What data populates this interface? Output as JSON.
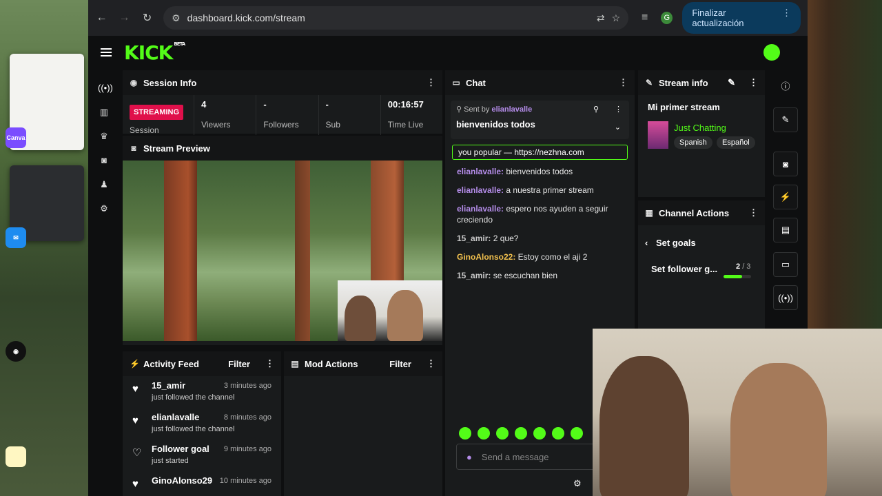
{
  "browser": {
    "url": "dashboard.kick.com/stream",
    "update_button": "Finalizar actualización",
    "profile_letter": "G"
  },
  "desktop": {
    "canva_label": "Canva"
  },
  "kick": {
    "logo": "KICK",
    "logo_badge": "BETA"
  },
  "session": {
    "title": "Session Info",
    "status_badge": "STREAMING",
    "status_label": "Session",
    "stats": [
      {
        "value": "4",
        "label": "Viewers"
      },
      {
        "value": "-",
        "label": "Followers"
      },
      {
        "value": "-",
        "label": "Sub"
      },
      {
        "value": "00:16:57",
        "label": "Time Live"
      }
    ]
  },
  "preview": {
    "title": "Stream Preview"
  },
  "activity": {
    "title": "Activity Feed",
    "filter": "Filter",
    "items": [
      {
        "name": "15_amir",
        "sub": "just followed the channel",
        "time": "3 minutes ago"
      },
      {
        "name": "elianlavalle",
        "sub": "just followed the channel",
        "time": "8 minutes ago"
      },
      {
        "name": "Follower goal",
        "sub": "just started",
        "time": "9 minutes ago"
      },
      {
        "name": "GinoAlonso29",
        "sub": "",
        "time": "10 minutes ago"
      }
    ]
  },
  "mod": {
    "title": "Mod Actions",
    "filter": "Filter"
  },
  "chat": {
    "title": "Chat",
    "pinned_prefix": "Sent by",
    "pinned_user": "elianlavalle",
    "pinned_message": "bienvenidos todos",
    "promo": "you popular — https://nezhna.com",
    "messages": [
      {
        "user": "elianlavalle",
        "text": "bienvenidos todos",
        "color": "#b48ce9"
      },
      {
        "user": "elianlavalle",
        "text": "a nuestra primer stream",
        "color": "#b48ce9"
      },
      {
        "user": "elianlavalle",
        "text": "espero nos ayuden a seguir creciendo",
        "color": "#b48ce9"
      },
      {
        "user": "15_amir",
        "text": "2 que?",
        "color": "#c8c8c8"
      },
      {
        "user": "GinoAlonso22",
        "text": "Estoy como el aji 2",
        "color": "#f2c14e"
      },
      {
        "user": "15_amir",
        "text": "se escuchan bien",
        "color": "#c8c8c8"
      }
    ],
    "placeholder": "Send a message"
  },
  "stream_info": {
    "title": "Stream info",
    "stream_title": "Mi primer stream",
    "category": "Just Chatting",
    "tags": [
      "Spanish",
      "Español"
    ]
  },
  "channel_actions": {
    "title": "Channel Actions",
    "subtitle": "Set goals",
    "goal_label": "Set follower g...",
    "goal_current": "2",
    "goal_total": "/ 3",
    "goal_fraction": 0.67
  },
  "colors": {
    "kick_green": "#53fc18",
    "streaming_red": "#e0104b"
  }
}
